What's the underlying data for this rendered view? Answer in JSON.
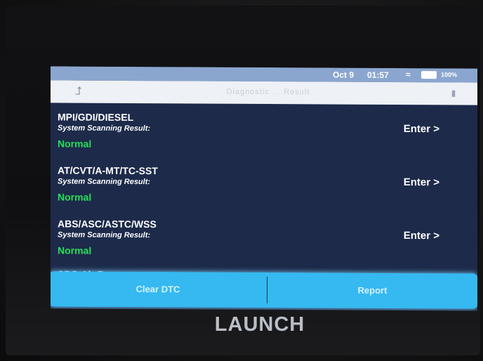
{
  "status_bar": {
    "date": "Oct 9",
    "time": "01:57",
    "battery": "100%"
  },
  "title_bar": {
    "title": "Diagnostic ... Result"
  },
  "systems": [
    {
      "name": "MPI/GDI/DIESEL",
      "label": "System Scanning Result:",
      "status": "Normal",
      "action": "Enter >"
    },
    {
      "name": "AT/CVT/A-MT/TC-SST",
      "label": "System Scanning Result:",
      "status": "Normal",
      "action": "Enter >"
    },
    {
      "name": "ABS/ASC/ASTC/WSS",
      "label": "System Scanning Result:",
      "status": "Normal",
      "action": "Enter >"
    },
    {
      "name": "SRS-Air Bag"
    }
  ],
  "bottom_bar": {
    "left_button": "Clear DTC",
    "right_button": "Report"
  },
  "brand": "LAUNCH"
}
